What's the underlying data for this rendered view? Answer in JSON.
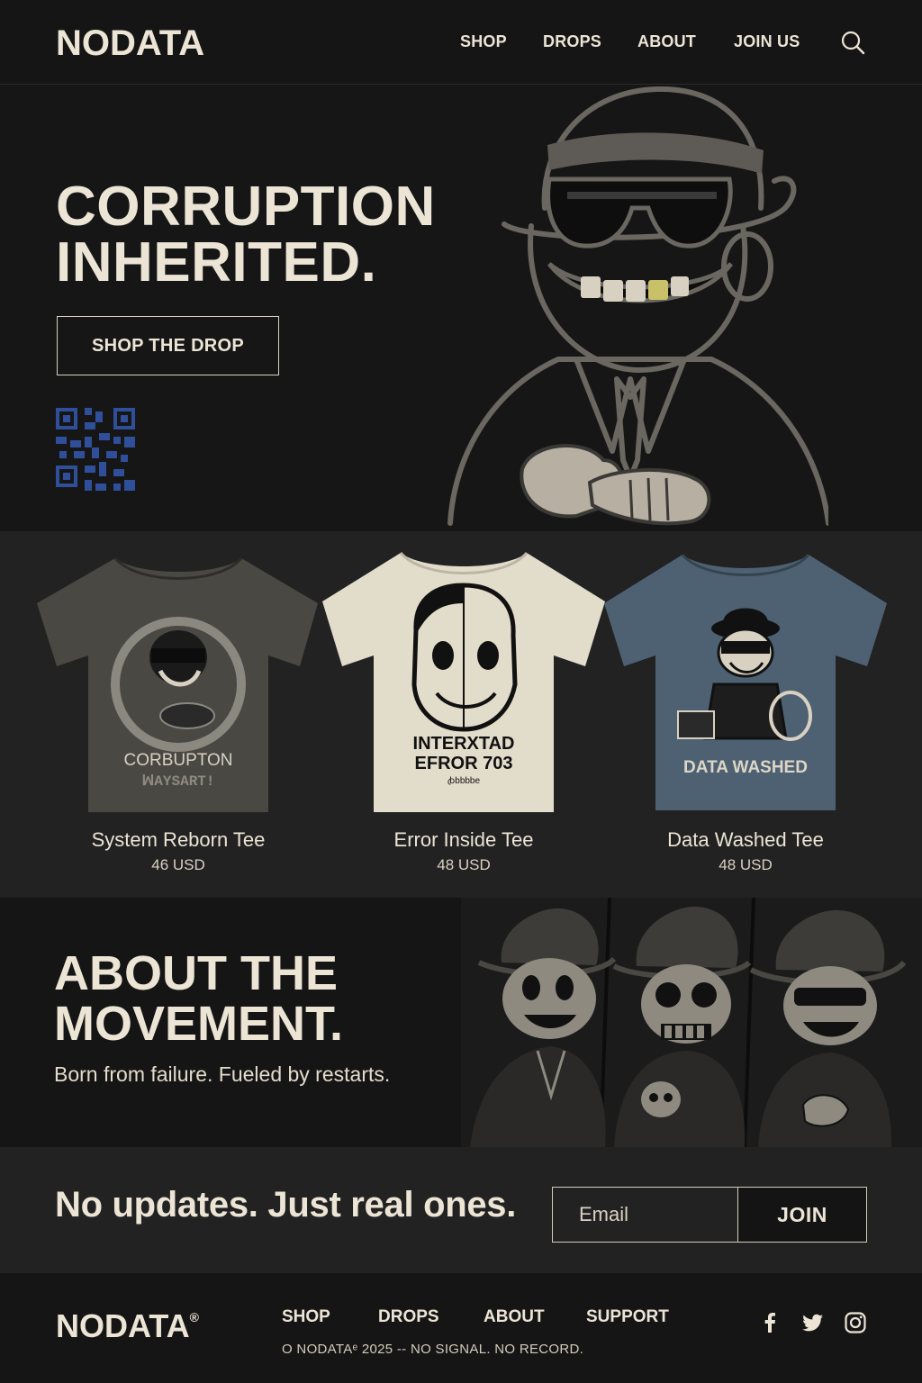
{
  "header": {
    "logo": "NODATA",
    "nav": [
      "SHOP",
      "DROPS",
      "ABOUT",
      "JOIN US"
    ],
    "search_icon": "search-icon"
  },
  "hero": {
    "title_line1": "CORRUPTION",
    "title_line2": "INHERITED.",
    "cta": "SHOP THE DROP"
  },
  "products": [
    {
      "name": "System Reborn Tee",
      "price": "46 USD",
      "shirt_color": "#4a4843",
      "print_line1": "CORBUPTON",
      "print_line2": "ꟽAYSART!"
    },
    {
      "name": "Error Inside Tee",
      "price": "48 USD",
      "shirt_color": "#e2dccb",
      "print_line1": "INTERXTAD",
      "print_line2": "EFROR 703",
      "print_line3": "ꞗbbbbe"
    },
    {
      "name": "Data Washed Tee",
      "price": "48 USD",
      "shirt_color": "#4d6173",
      "print_line1": "DATA WASHED"
    }
  ],
  "about": {
    "title_line1": "ABOUT THE",
    "title_line2": "MOVEMENT.",
    "text": "Born from failure. Fueled by restarts."
  },
  "newsletter": {
    "text": "No updates. Just real ones.",
    "email_placeholder": "Email",
    "join_label": "JOIN"
  },
  "footer": {
    "logo": "NODATA",
    "registered": "®",
    "nav": [
      "SHOP",
      "DROPS",
      "ABOUT",
      "SUPPORT"
    ],
    "copyright": "O NODATAᵉ 2025 -- NO SIGNAL. NO RECORD.",
    "social": [
      "facebook-icon",
      "twitter-icon",
      "instagram-icon"
    ]
  },
  "colors": {
    "background": "#151515",
    "band": "#222222",
    "cream": "#ece5d6",
    "qr_blue": "#2f4f9a",
    "gold_tooth": "#c9c06a"
  }
}
